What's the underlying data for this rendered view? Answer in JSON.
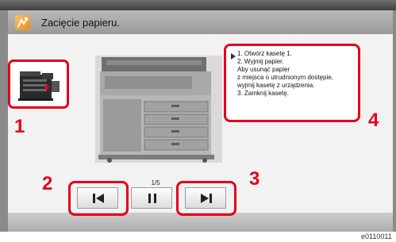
{
  "header": {
    "title": "Zacięcie papieru."
  },
  "instructions": {
    "lines": [
      "1. Otwórz kasetę 1.",
      "2. Wyjmij papier.",
      "Aby usunąć papier",
      "z miejsca o utrudnionym dostępie,",
      "wyjmij kasetę z urządzenia.",
      "3. Zamknij kasetę."
    ]
  },
  "callouts": {
    "c1": "1",
    "c2": "2",
    "c3": "3",
    "c4": "4"
  },
  "playback": {
    "page_indicator": "1/5"
  },
  "footer": {
    "code": "e0110011"
  },
  "icons": {
    "warning": "paper-jam-warning-icon",
    "back": "skip-back-icon",
    "pause": "pause-icon",
    "next": "skip-forward-icon"
  },
  "colors": {
    "highlight": "#e4001c",
    "warning": "#e38f1c"
  }
}
